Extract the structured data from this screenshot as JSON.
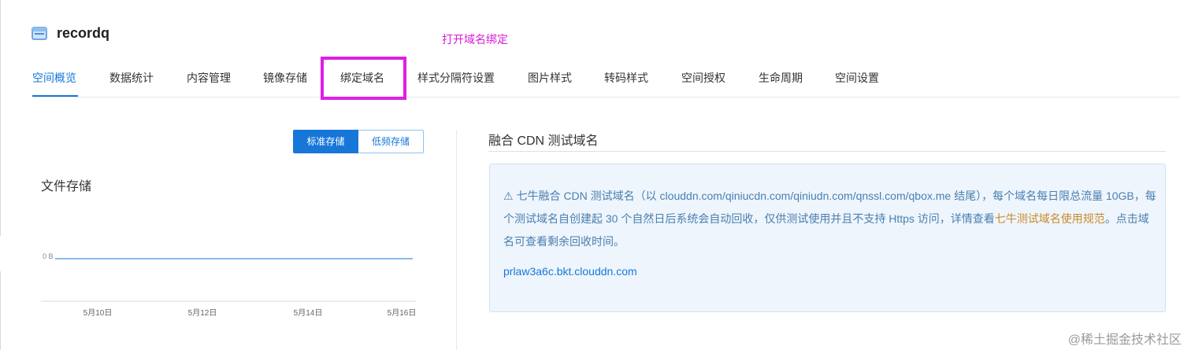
{
  "header": {
    "bucket_name": "recordq",
    "icon": "bucket-icon"
  },
  "annotation": "打开域名绑定",
  "tabs": [
    {
      "label": "空间概览",
      "active": true
    },
    {
      "label": "数据统计",
      "active": false
    },
    {
      "label": "内容管理",
      "active": false
    },
    {
      "label": "镜像存储",
      "active": false
    },
    {
      "label": "绑定域名",
      "active": false,
      "highlighted": true
    },
    {
      "label": "样式分隔符设置",
      "active": false
    },
    {
      "label": "图片样式",
      "active": false
    },
    {
      "label": "转码样式",
      "active": false
    },
    {
      "label": "空间授权",
      "active": false
    },
    {
      "label": "生命周期",
      "active": false
    },
    {
      "label": "空间设置",
      "active": false
    }
  ],
  "storage_toggle": {
    "standard": "标准存储",
    "low_frequency": "低频存储",
    "selected": "标准存储"
  },
  "file_storage": {
    "title": "文件存储"
  },
  "chart_data": {
    "type": "line",
    "title": "文件存储",
    "x": [
      "5月10日",
      "5月12日",
      "5月14日",
      "5月16日"
    ],
    "series": [
      {
        "values": [
          0,
          0,
          0,
          0
        ]
      }
    ],
    "y_tick_label": "0 B",
    "color": "#1677d9"
  },
  "cdn": {
    "title": "融合 CDN 测试域名",
    "notice_icon": "warning-icon",
    "notice_text": "七牛融合 CDN 测试域名（以 clouddn.com/qiniucdn.com/qiniudn.com/qnssl.com/qbox.me 结尾），每个域名每日限总流量 10GB，每个测试域名自创建起 30 个自然日后系统会自动回收，仅供测试使用并且不支持 Https 访问，详情查看",
    "notice_link": "七牛测试域名使用规范",
    "notice_tail": "。点击域名可查看剩余回收时间。",
    "domain": "prlaw3a6c.bkt.clouddn.com"
  },
  "watermark": "@稀土掘金技术社区",
  "colors": {
    "accent": "#1677d9",
    "annotation": "#d41dd6",
    "notice_link": "#c98a2e"
  }
}
